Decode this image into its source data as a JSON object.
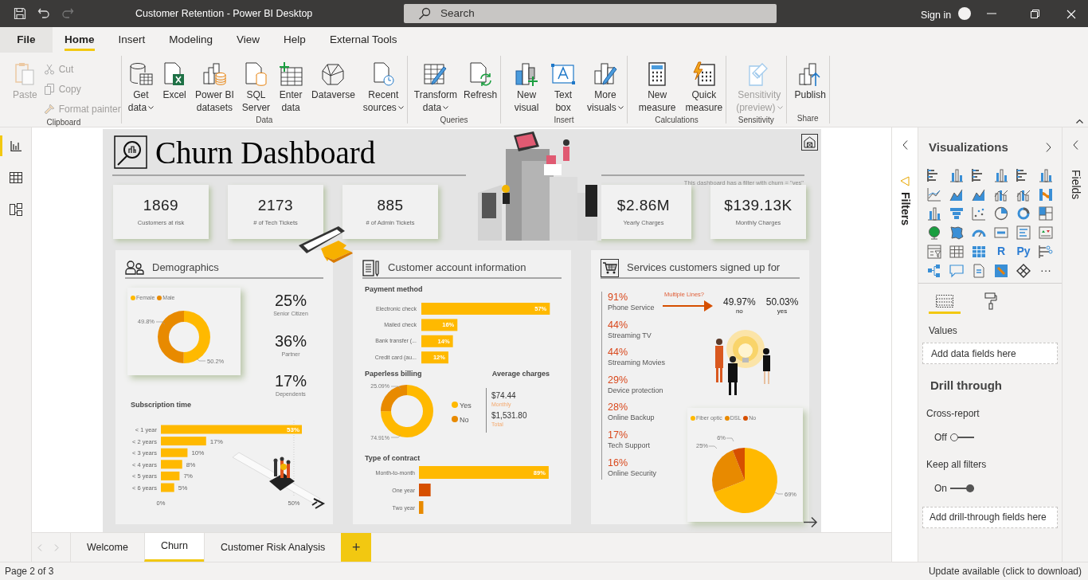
{
  "window": {
    "title": "Customer Retention - Power BI Desktop",
    "search_placeholder": "Search",
    "sign_in": "Sign in"
  },
  "menu_tabs": [
    {
      "label": "File",
      "selected": false
    },
    {
      "label": "Home",
      "selected": true
    },
    {
      "label": "Insert",
      "selected": false
    },
    {
      "label": "Modeling",
      "selected": false
    },
    {
      "label": "View",
      "selected": false
    },
    {
      "label": "Help",
      "selected": false
    },
    {
      "label": "External Tools",
      "selected": false
    }
  ],
  "ribbon": [
    {
      "group": "Clipboard",
      "buttons": [
        {
          "lines": [
            "Paste"
          ],
          "kind": "large",
          "disabled": true,
          "dropdown": false
        },
        {
          "lines": [
            "Cut"
          ],
          "kind": "small",
          "disabled": true,
          "dropdown": false
        },
        {
          "lines": [
            "Copy"
          ],
          "kind": "small",
          "disabled": true,
          "dropdown": false
        },
        {
          "lines": [
            "Format painter"
          ],
          "kind": "small",
          "disabled": true,
          "dropdown": false
        }
      ]
    },
    {
      "group": "Data",
      "buttons": [
        {
          "lines": [
            "Get",
            "data"
          ],
          "kind": "large",
          "disabled": false,
          "dropdown": true
        },
        {
          "lines": [
            "Excel"
          ],
          "kind": "large",
          "disabled": false,
          "dropdown": false
        },
        {
          "lines": [
            "Power BI",
            "datasets"
          ],
          "kind": "large",
          "disabled": false,
          "dropdown": false
        },
        {
          "lines": [
            "SQL",
            "Server"
          ],
          "kind": "large",
          "disabled": false,
          "dropdown": false
        },
        {
          "lines": [
            "Enter",
            "data"
          ],
          "kind": "large",
          "disabled": false,
          "dropdown": false
        },
        {
          "lines": [
            "Dataverse"
          ],
          "kind": "large",
          "disabled": false,
          "dropdown": false
        },
        {
          "lines": [
            "Recent",
            "sources"
          ],
          "kind": "large",
          "disabled": false,
          "dropdown": true
        }
      ]
    },
    {
      "group": "Queries",
      "buttons": [
        {
          "lines": [
            "Transform",
            "data"
          ],
          "kind": "large",
          "disabled": false,
          "dropdown": true
        },
        {
          "lines": [
            "Refresh"
          ],
          "kind": "large",
          "disabled": false,
          "dropdown": false
        }
      ]
    },
    {
      "group": "Insert",
      "buttons": [
        {
          "lines": [
            "New",
            "visual"
          ],
          "kind": "large",
          "disabled": false,
          "dropdown": false
        },
        {
          "lines": [
            "Text",
            "box"
          ],
          "kind": "large",
          "disabled": false,
          "dropdown": false
        },
        {
          "lines": [
            "More",
            "visuals"
          ],
          "kind": "large",
          "disabled": false,
          "dropdown": true
        }
      ]
    },
    {
      "group": "Calculations",
      "buttons": [
        {
          "lines": [
            "New",
            "measure"
          ],
          "kind": "large",
          "disabled": false,
          "dropdown": false
        },
        {
          "lines": [
            "Quick",
            "measure"
          ],
          "kind": "large",
          "disabled": false,
          "dropdown": false
        }
      ]
    },
    {
      "group": "Sensitivity",
      "buttons": [
        {
          "lines": [
            "Sensitivity",
            "(preview)"
          ],
          "kind": "large",
          "disabled": true,
          "dropdown": true
        }
      ]
    },
    {
      "group": "Share",
      "buttons": [
        {
          "lines": [
            "Publish"
          ],
          "kind": "large",
          "disabled": false,
          "dropdown": false
        }
      ]
    }
  ],
  "view_switcher": [
    {
      "selected": true
    },
    {
      "selected": false
    },
    {
      "selected": false
    }
  ],
  "report": {
    "title": "Churn Dashboard",
    "filter_note": "This dashboard has a filter with churn = \"yes\"",
    "kpis": [
      {
        "value": "1869",
        "label": "Customers at risk"
      },
      {
        "value": "2173",
        "label": "# of Tech Tickets"
      },
      {
        "value": "885",
        "label": "# of Admin Tickets"
      },
      {
        "value": "$2.86M",
        "label": "Yearly Charges"
      },
      {
        "value": "$139.13K",
        "label": "Monthly Charges"
      }
    ],
    "demographics": {
      "title": "Demographics",
      "gender_chart": {
        "chart_data": {
          "type": "donut",
          "legend": "top",
          "categories": [
            "Female",
            "Male"
          ],
          "values": [
            50.2,
            49.8
          ],
          "value_labels": [
            "50.2%",
            "49.8%"
          ]
        }
      },
      "stats": [
        {
          "value": "25%",
          "label": "Senior Citizen"
        },
        {
          "value": "36%",
          "label": "Partner"
        },
        {
          "value": "17%",
          "label": "Dependents"
        }
      ],
      "subscription_title": "Subscription time",
      "subscription_chart": {
        "chart_data": {
          "type": "bar",
          "orientation": "horizontal",
          "categories": [
            "< 1 year",
            "< 2 years",
            "< 3 years",
            "< 4 years",
            "< 5 years",
            "< 6 years"
          ],
          "values": [
            53,
            17,
            10,
            8,
            7,
            5
          ],
          "value_labels": [
            "53%",
            "17%",
            "10%",
            "8%",
            "7%",
            "5%"
          ],
          "xlim": [
            0,
            53
          ],
          "xticks": [
            {
              "value": 0,
              "label": "0%"
            },
            {
              "value": 50,
              "label": "50%"
            }
          ]
        }
      }
    },
    "account": {
      "title": "Customer account information",
      "payment_title": "Payment method",
      "payment_chart": {
        "chart_data": {
          "type": "bar",
          "orientation": "horizontal",
          "categories": [
            "Electronic check",
            "Mailed check",
            "Bank transfer (...",
            "Credit card (au..."
          ],
          "values": [
            57,
            16,
            14,
            12
          ],
          "value_labels": [
            "57%",
            "16%",
            "14%",
            "12%"
          ]
        }
      },
      "paperless_title": "Paperless billing",
      "paperless_chart": {
        "chart_data": {
          "type": "donut",
          "legend": "right",
          "categories": [
            "Yes",
            "No"
          ],
          "values": [
            74.91,
            25.09
          ],
          "value_labels": [
            "74.91%",
            "25.09%"
          ]
        }
      },
      "charges_title": "Average charges",
      "charges": [
        {
          "value": "$74.44",
          "label": "Monthly"
        },
        {
          "value": "$1,531.80",
          "label": "Total"
        }
      ],
      "contract_title": "Type of contract",
      "contract_chart": {
        "chart_data": {
          "type": "bar",
          "orientation": "horizontal",
          "categories": [
            "Month-to-month",
            "One year",
            "Two year"
          ],
          "values": [
            89,
            8,
            3
          ],
          "value_labels": [
            "89%",
            null,
            null
          ]
        }
      }
    },
    "services": {
      "title": "Services customers signed up for",
      "items": [
        {
          "value": "91%",
          "label": "Phone Service"
        },
        {
          "value": "44%",
          "label": "Streaming TV"
        },
        {
          "value": "44%",
          "label": "Streaming Movies"
        },
        {
          "value": "29%",
          "label": "Device protection"
        },
        {
          "value": "28%",
          "label": "Online Backup"
        },
        {
          "value": "17%",
          "label": "Tech Support"
        },
        {
          "value": "16%",
          "label": "Online Security"
        }
      ],
      "multiple_lines": {
        "label": "Multiple Lines?",
        "split": [
          {
            "value": "49.97%",
            "label": "no"
          },
          {
            "value": "50.03%",
            "label": "yes"
          }
        ]
      },
      "internet_chart": {
        "chart_data": {
          "type": "pie",
          "legend": "top",
          "categories": [
            "Fiber optic",
            "DSL",
            "No"
          ],
          "values": [
            69,
            25,
            6
          ],
          "value_labels": [
            "69%",
            "25%",
            "6%"
          ]
        }
      }
    }
  },
  "page_tabs": [
    {
      "label": "Welcome",
      "selected": false
    },
    {
      "label": "Churn",
      "selected": true
    },
    {
      "label": "Customer Risk Analysis",
      "selected": false
    }
  ],
  "add_page": "+",
  "filters_pane": {
    "title": "Filters"
  },
  "visualizations": {
    "title": "Visualizations",
    "glyphs": [
      "R",
      "Py",
      "···"
    ],
    "pane_tabs": [
      {
        "selected": true
      },
      {
        "selected": false
      }
    ],
    "values_label": "Values",
    "values_well": "Add data fields here",
    "drill_title": "Drill through",
    "toggles": [
      {
        "label": "Cross-report",
        "state_label": "Off",
        "on": false
      },
      {
        "label": "Keep all filters",
        "state_label": "On",
        "on": true
      }
    ],
    "drill_well": "Add drill-through fields here"
  },
  "fields_pane": {
    "title": "Fields"
  },
  "status_bar": {
    "page": "Page 2 of 3",
    "update": "Update available (click to download)"
  }
}
